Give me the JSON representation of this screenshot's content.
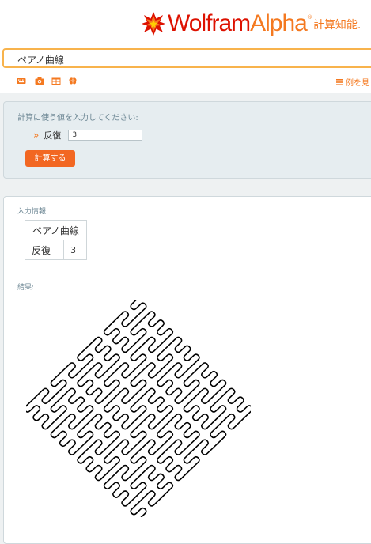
{
  "logo": {
    "word_main": "Wolfram",
    "word_accent": "Alpha",
    "tagline": "計算知能.",
    "brand_red": "#dd1100",
    "brand_orange": "#f47920"
  },
  "search": {
    "value": "ペアノ曲線"
  },
  "toolbar": {
    "icons": [
      "keyboard-icon",
      "camera-icon",
      "table-icon",
      "brain-icon"
    ],
    "examples_label": "例を見"
  },
  "input_panel": {
    "prompt": "計算に使う値を入力してください:",
    "param_label": "反復",
    "param_value": "3",
    "submit_label": "計算する",
    "button_color": "#f26722"
  },
  "result_panel": {
    "input_pod_title": "入力情報:",
    "input_table": {
      "header": "ペアノ曲線",
      "row_label": "反復",
      "row_value": "3"
    },
    "result_pod_title": "結果:"
  },
  "chart_data": {
    "type": "image",
    "description_hidden": false,
    "curve": "Peano curve",
    "iterations": 3,
    "stroke_color": "#000000"
  }
}
